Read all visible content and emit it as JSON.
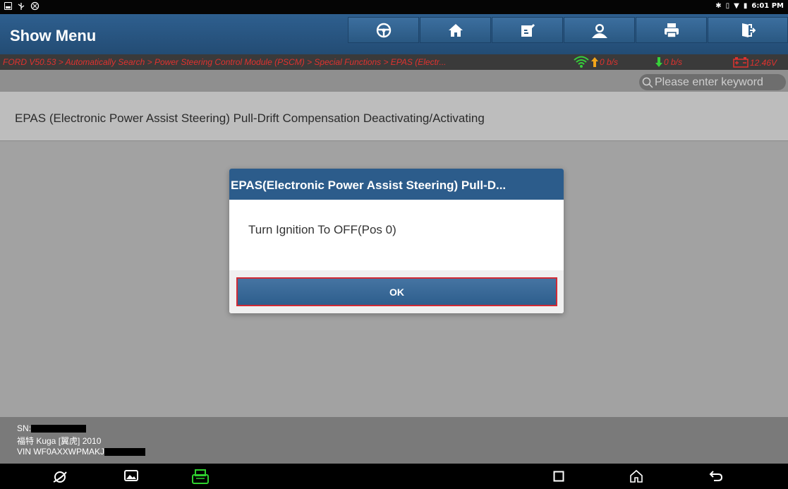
{
  "status_bar": {
    "time": "6:01 PM",
    "left_icons": [
      "notification-box-icon",
      "usb-icon",
      "vpn-icon"
    ],
    "right_icons": [
      "bluetooth-icon",
      "vibrate-icon",
      "wifi-icon",
      "battery-icon"
    ]
  },
  "header": {
    "title": "Show Menu",
    "nav_buttons": [
      {
        "name": "steering-wheel-icon"
      },
      {
        "name": "home-icon"
      },
      {
        "name": "edit-report-icon"
      },
      {
        "name": "user-icon"
      },
      {
        "name": "print-icon"
      },
      {
        "name": "exit-icon"
      }
    ]
  },
  "breadcrumb": {
    "path": "FORD V50.53 > Automatically Search > Power Steering Control Module (PSCM) > Special Functions > EPAS (Electr...",
    "upload": "0 b/s",
    "download": "0 b/s",
    "voltage": "12.46V"
  },
  "search": {
    "placeholder": "Please enter keyword"
  },
  "menu": {
    "items": [
      {
        "label": "EPAS (Electronic Power Assist Steering) Pull-Drift Compensation Deactivating/Activating"
      }
    ]
  },
  "dialog": {
    "title": "EPAS(Electronic Power Assist Steering) Pull-D...",
    "message": "Turn Ignition To OFF(Pos 0)",
    "ok_label": "OK"
  },
  "vehicle_info": {
    "sn_label": "SN:",
    "model": "福特 Kuga [翼虎] 2010",
    "vin_prefix": "VIN WF0AXXWPMAKJ"
  },
  "colors": {
    "header_blue": "#2b5a88",
    "breadcrumb_red": "#e0322e",
    "ok_border": "#d12a35",
    "vci_green": "#2ed12e"
  }
}
